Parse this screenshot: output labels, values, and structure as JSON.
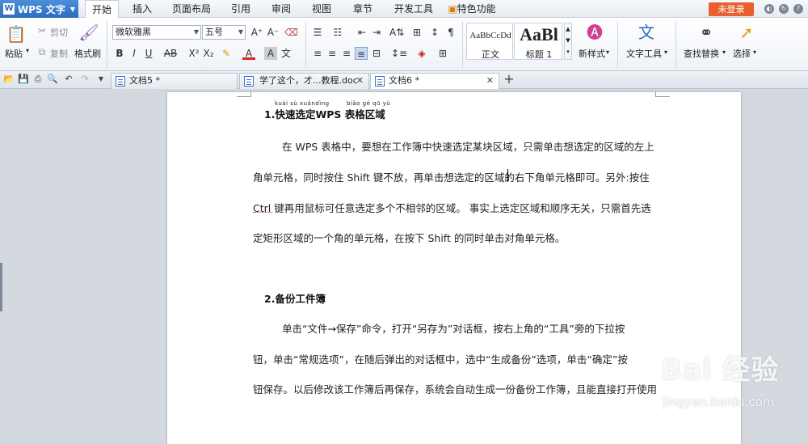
{
  "app": {
    "name": "WPS 文字"
  },
  "menu": {
    "tabs": [
      "开始",
      "插入",
      "页面布局",
      "引用",
      "审阅",
      "视图",
      "章节",
      "开发工具",
      "特色功能"
    ],
    "active": "开始",
    "login_label": "未登录"
  },
  "ribbon": {
    "paste": "粘贴",
    "cut": "剪切",
    "copy": "复制",
    "format_painter": "格式刷",
    "font_name": "微软雅黑",
    "font_size": "五号",
    "style_normal_preview": "AaBbCcDd",
    "style_normal_label": "正文",
    "style_h1_preview": "AaBl",
    "style_h1_label": "标题 1",
    "new_style": "新样式",
    "text_tools": "文字工具",
    "find_replace": "查找替换",
    "select": "选择"
  },
  "tabs": [
    {
      "label": "文档5 *",
      "active": false
    },
    {
      "label": "学了这个，才...教程.doc",
      "active": false
    },
    {
      "label": "文档6 *",
      "active": true
    }
  ],
  "document": {
    "heading1_text": "1.快速选定WPS  表格区域",
    "heading1_ruby_a": "kuài sù xuǎndìng",
    "heading1_ruby_b": "biǎo gé qū yù",
    "para1": [
      "在 WPS 表格中，要想在工作簿中快速选定某块区域，只需单击想选定的区域的左上",
      "角单元格，同时按住 Shift 键不放，再单击想选定的区域的右下角单元格即可。另外:按住",
      "Ctrl 键再用鼠标可任意选定多个不相邻的区域。 事实上选定区域和顺序无关，只需首先选",
      "定矩形区域的一个角的单元格，在按下 Shift 的同时单击对角单元格。"
    ],
    "heading2_text": "2.备份工件簿",
    "para2": [
      "单击“文件→保存”命令，打开“另存为”对话框，按右上角的“工具”旁的下拉按",
      "钮，单击“常规选项”，在随后弹出的对话框中，选中“生成备份”选项，单击“确定”按",
      "钮保存。以后修改该工作簿后再保存，系统会自动生成一份备份工作簿，且能直接打开使用"
    ]
  },
  "watermark": {
    "brand": "Bai 经验",
    "url": "jingyan.baidu.com"
  },
  "colors": {
    "accent": "#2b6cc0",
    "login": "#e8612c"
  }
}
